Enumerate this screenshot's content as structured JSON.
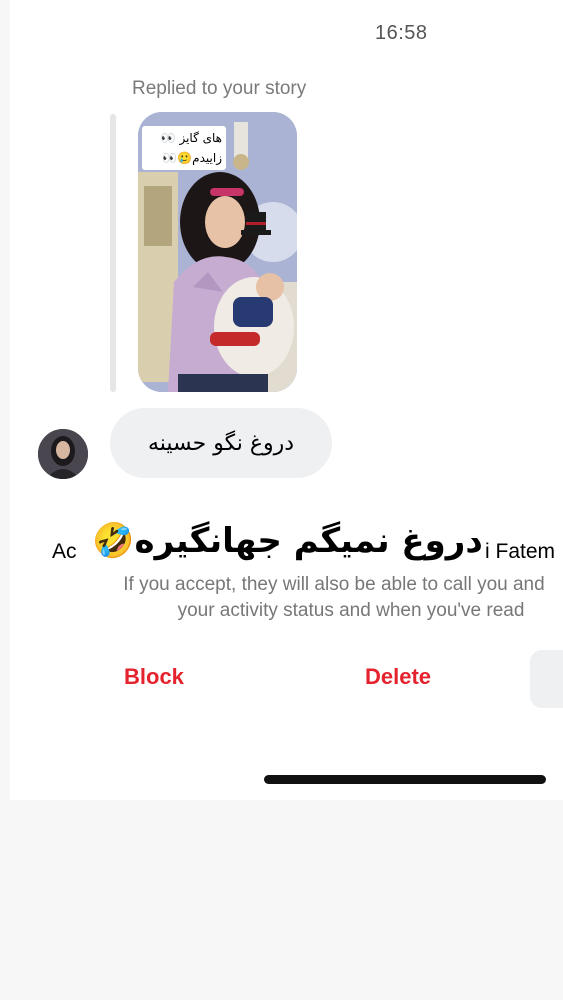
{
  "status_bar": {
    "time": "16:58"
  },
  "thread": {
    "replied_label": "Replied to your story",
    "story_caption_line1": "های گایز 👀",
    "story_caption_line2": "زاییدم🥲👀",
    "message_text": "دروغ نگو حسینه"
  },
  "sticker_text": "دروغ نمیگم جهانگیره🤣",
  "request": {
    "title_left": "Ac",
    "title_right": "i Fatem",
    "info_line1": "If you accept, they will also be able to call you and",
    "info_line2": "your activity status and when you've read"
  },
  "actions": {
    "block_label": "Block",
    "delete_label": "Delete",
    "accent_color": "#e5232f"
  }
}
